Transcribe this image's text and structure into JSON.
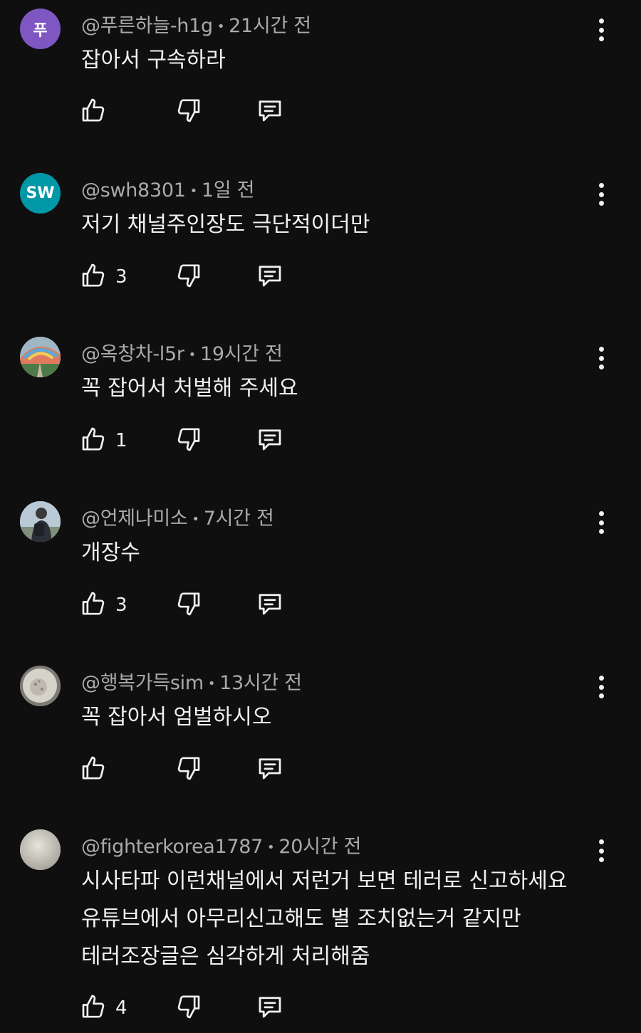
{
  "comments": [
    {
      "avatar_letter": "푸",
      "avatar_color": "#7e57c2",
      "handle": "@푸른하늘-h1g",
      "time": "21시간 전",
      "lines": [
        "잡아서 구속하라"
      ],
      "likes": ""
    },
    {
      "avatar_letter": "SW",
      "avatar_color": "#0097a7",
      "handle": "@swh8301",
      "time": "1일 전",
      "lines": [
        "저기 채널주인장도  극단적이더만"
      ],
      "likes": "3"
    },
    {
      "avatar_letter": "",
      "avatar_color": "#6b8e9f",
      "handle": "@옥창차-l5r",
      "time": "19시간 전",
      "lines": [
        "꼭 잡어서 처벌해 주세요"
      ],
      "likes": "1"
    },
    {
      "avatar_letter": "",
      "avatar_color": "#8fa3b5",
      "handle": "@언제나미소",
      "time": "7시간 전",
      "lines": [
        "개장수"
      ],
      "likes": "3"
    },
    {
      "avatar_letter": "",
      "avatar_color": "#9a9890",
      "handle": "@행복가득sim",
      "time": "13시간 전",
      "lines": [
        "꼭 잡아서 엄벌하시오"
      ],
      "likes": ""
    },
    {
      "avatar_letter": "",
      "avatar_color": "#c8c6bd",
      "handle": "@fighterkorea1787",
      "time": "20시간 전",
      "lines": [
        "시사타파 이런채널에서 저런거 보면 테러로 신고하세요",
        "유튜브에서 아무리신고해도 별 조치없는거 같지만",
        "테러조장글은 심각하게 처리해줌"
      ],
      "likes": "4"
    }
  ],
  "icons": {
    "like": "thumbs-up-icon",
    "dislike": "thumbs-down-icon",
    "reply": "reply-icon",
    "more": "more-vert-icon"
  },
  "colors": {
    "background": "#0f0f0f",
    "text": "#f1f1f1",
    "meta": "#aaaaaa"
  }
}
